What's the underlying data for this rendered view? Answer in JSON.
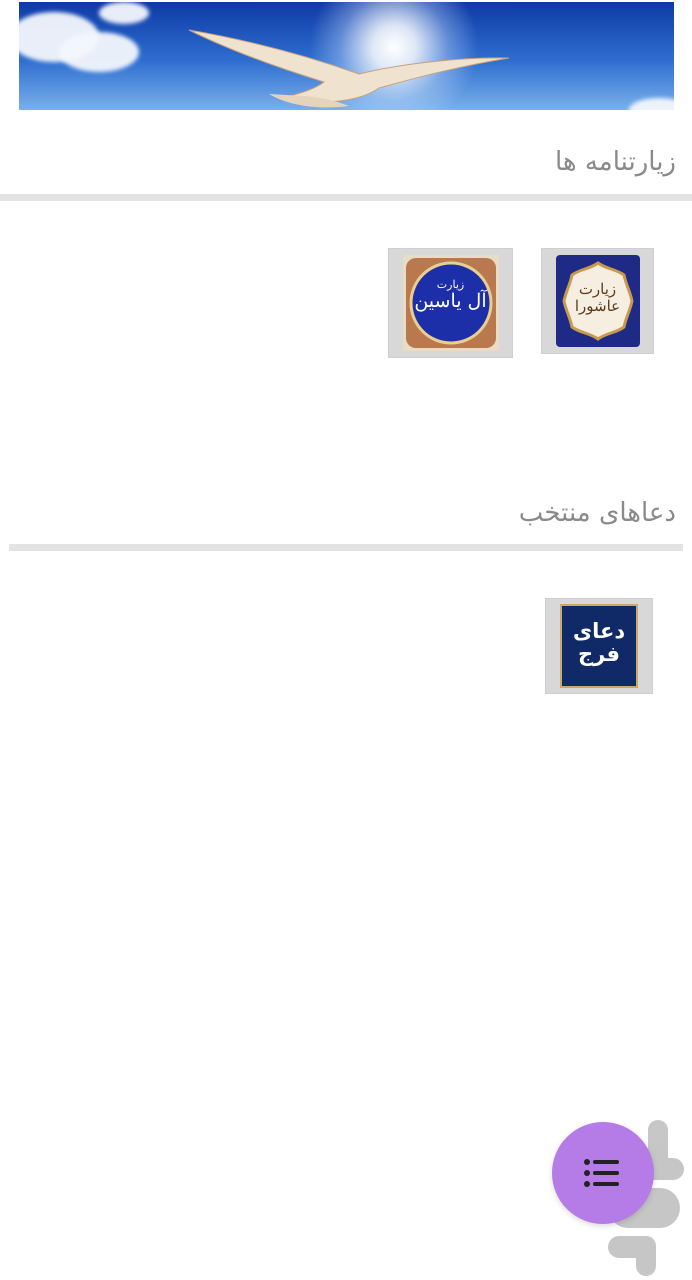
{
  "banner": {
    "icon": "dove-in-sky-image"
  },
  "sections": [
    {
      "title": "زیارتنامه ها",
      "items": [
        {
          "line1": "زیارت",
          "line2": "عاشورا"
        },
        {
          "line1": "زیارت",
          "line2": "آل یاسین"
        }
      ]
    },
    {
      "title": "دعاهای منتخب",
      "items": [
        {
          "line1": "دعای",
          "line2": "فرج"
        }
      ]
    }
  ],
  "fab": {
    "icon": "list-menu-icon"
  },
  "colors": {
    "fab": "#b57be6",
    "title_text": "#8a8a8a",
    "divider": "#e3e3e3",
    "tile_bg": "#d8d8d8"
  }
}
